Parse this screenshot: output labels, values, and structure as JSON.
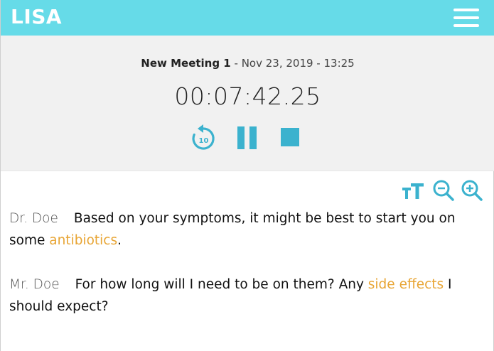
{
  "app": {
    "title": "LISA"
  },
  "meeting": {
    "name": "New Meeting 1",
    "meta": " - Nov 23, 2019 - 13:25",
    "timer": "00:07:42.25"
  },
  "controls": {
    "rewind_seconds": "10"
  },
  "transcript": [
    {
      "speaker": "Dr. Doe",
      "before": "Based on your symptoms, it might be best to start you on some ",
      "keyword": "antibiotics",
      "after": "."
    },
    {
      "speaker": "Mr. Doe",
      "before": "For how long will I need to be on them? Any ",
      "keyword": "side effects",
      "after": " I should expect?"
    }
  ],
  "colors": {
    "header": "#66dbe8",
    "accent": "#3bb2ce",
    "keyword": "#e8a534",
    "panel": "#f1f1f1"
  },
  "icons": [
    "menu-icon",
    "rewind-10-icon",
    "pause-icon",
    "stop-icon",
    "text-size-icon",
    "zoom-out-icon",
    "zoom-in-icon"
  ]
}
